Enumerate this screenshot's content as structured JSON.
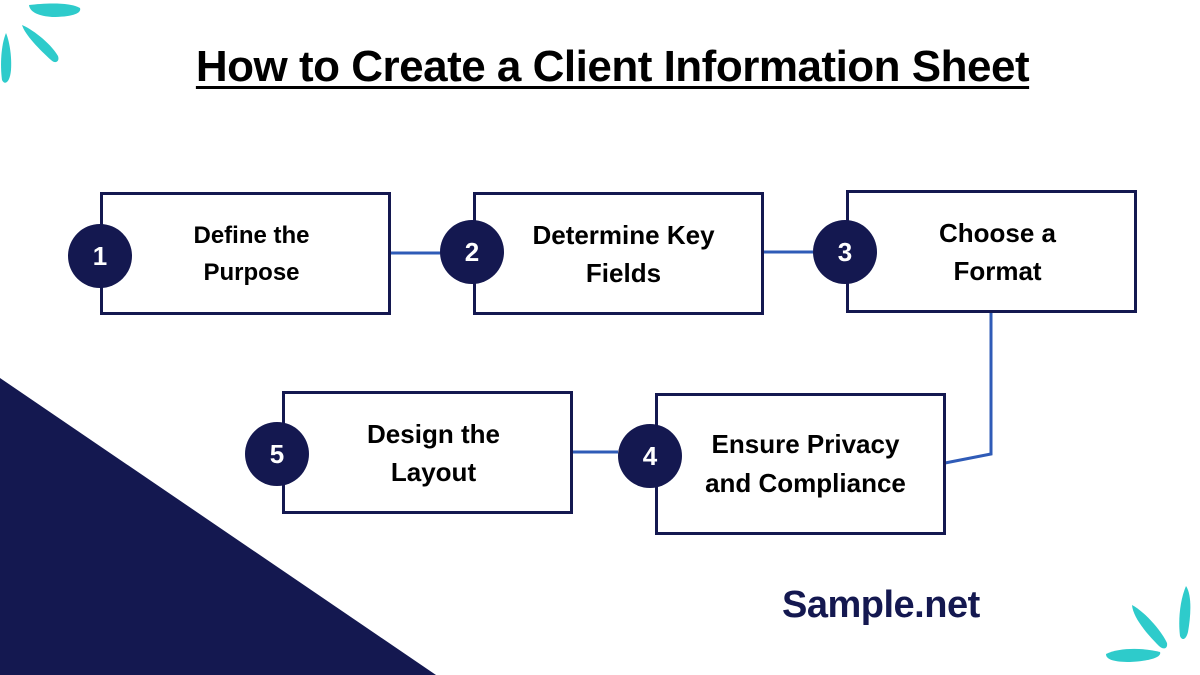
{
  "title": "How to Create a Client Information Sheet",
  "colors": {
    "navy": "#141850",
    "teal": "#2ECBCB",
    "connector": "#2F5BB7",
    "text": "#000000"
  },
  "steps": [
    {
      "number": "1",
      "label": "Define the Purpose"
    },
    {
      "number": "2",
      "label": "Determine Key Fields"
    },
    {
      "number": "3",
      "label": "Choose a Format"
    },
    {
      "number": "4",
      "label": "Ensure Privacy and Compliance"
    },
    {
      "number": "5",
      "label": "Design the Layout"
    }
  ],
  "brand": "Sample.net",
  "decorations": {
    "top_left": "teal-petal-burst",
    "bottom_right": "teal-petal-burst",
    "bottom_left": "navy-triangle"
  }
}
